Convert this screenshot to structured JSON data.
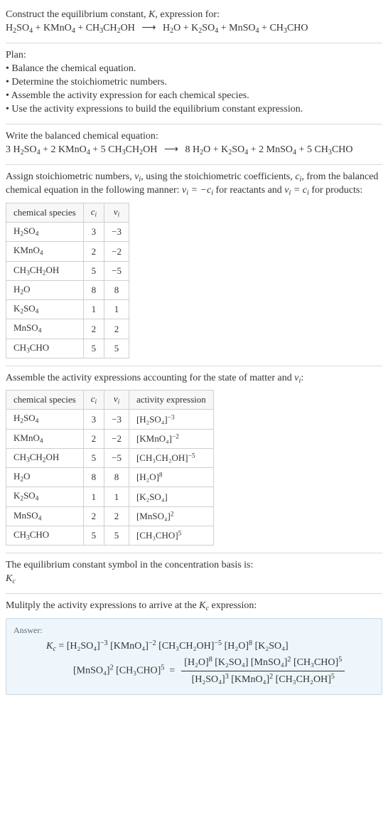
{
  "header": {
    "line1_pre": "Construct the equilibrium constant, ",
    "line1_post": ", expression for:",
    "reaction": {
      "reactants": [
        "H₂SO₄",
        "KMnO₄",
        "CH₃CH₂OH"
      ],
      "products": [
        "H₂O",
        "K₂SO₄",
        "MnSO₄",
        "CH₃CHO"
      ]
    }
  },
  "plan": {
    "title": "Plan:",
    "items": [
      "Balance the chemical equation.",
      "Determine the stoichiometric numbers.",
      "Assemble the activity expression for each chemical species.",
      "Use the activity expressions to build the equilibrium constant expression."
    ]
  },
  "balanced": {
    "title": "Write the balanced chemical equation:",
    "reactants": [
      {
        "coef": "3",
        "sp": "H₂SO₄"
      },
      {
        "coef": "2",
        "sp": "KMnO₄"
      },
      {
        "coef": "5",
        "sp": "CH₃CH₂OH"
      }
    ],
    "products": [
      {
        "coef": "8",
        "sp": "H₂O"
      },
      {
        "coef": "",
        "sp": "K₂SO₄"
      },
      {
        "coef": "2",
        "sp": "MnSO₄"
      },
      {
        "coef": "5",
        "sp": "CH₃CHO"
      }
    ]
  },
  "assign_text_a": "Assign stoichiometric numbers, ",
  "assign_text_b": ", using the stoichiometric coefficients, ",
  "assign_text_c": ", from the balanced chemical equation in the following manner: ",
  "assign_text_d": " for reactants and ",
  "assign_text_e": " for products:",
  "table1": {
    "headers": [
      "chemical species",
      "cᵢ",
      "νᵢ"
    ],
    "rows": [
      {
        "sp": "H₂SO₄",
        "c": "3",
        "v": "−3"
      },
      {
        "sp": "KMnO₄",
        "c": "2",
        "v": "−2"
      },
      {
        "sp": "CH₃CH₂OH",
        "c": "5",
        "v": "−5"
      },
      {
        "sp": "H₂O",
        "c": "8",
        "v": "8"
      },
      {
        "sp": "K₂SO₄",
        "c": "1",
        "v": "1"
      },
      {
        "sp": "MnSO₄",
        "c": "2",
        "v": "2"
      },
      {
        "sp": "CH₃CHO",
        "c": "5",
        "v": "5"
      }
    ]
  },
  "assemble_text_a": "Assemble the activity expressions accounting for the state of matter and ",
  "assemble_text_b": ":",
  "table2": {
    "headers": [
      "chemical species",
      "cᵢ",
      "νᵢ",
      "activity expression"
    ],
    "rows": [
      {
        "sp": "H₂SO₄",
        "c": "3",
        "v": "−3",
        "expr_base": "[H₂SO₄]",
        "expr_exp": "−3"
      },
      {
        "sp": "KMnO₄",
        "c": "2",
        "v": "−2",
        "expr_base": "[KMnO₄]",
        "expr_exp": "−2"
      },
      {
        "sp": "CH₃CH₂OH",
        "c": "5",
        "v": "−5",
        "expr_base": "[CH₃CH₂OH]",
        "expr_exp": "−5"
      },
      {
        "sp": "H₂O",
        "c": "8",
        "v": "8",
        "expr_base": "[H₂O]",
        "expr_exp": "8"
      },
      {
        "sp": "K₂SO₄",
        "c": "1",
        "v": "1",
        "expr_base": "[K₂SO₄]",
        "expr_exp": ""
      },
      {
        "sp": "MnSO₄",
        "c": "2",
        "v": "2",
        "expr_base": "[MnSO₄]",
        "expr_exp": "2"
      },
      {
        "sp": "CH₃CHO",
        "c": "5",
        "v": "5",
        "expr_base": "[CH₃CHO]",
        "expr_exp": "5"
      }
    ]
  },
  "symbol_text": "The equilibrium constant symbol in the concentration basis is:",
  "symbol": "K_c",
  "multiply_text_a": "Mulitply the activity expressions to arrive at the ",
  "multiply_text_b": " expression:",
  "answer": {
    "label": "Answer:",
    "line1": {
      "lhs": "K_c",
      "terms": [
        {
          "base": "[H₂SO₄]",
          "exp": "−3"
        },
        {
          "base": "[KMnO₄]",
          "exp": "−2"
        },
        {
          "base": "[CH₃CH₂OH]",
          "exp": "−5"
        },
        {
          "base": "[H₂O]",
          "exp": "8"
        },
        {
          "base": "[K₂SO₄]",
          "exp": ""
        }
      ]
    },
    "line2_terms": [
      {
        "base": "[MnSO₄]",
        "exp": "2"
      },
      {
        "base": "[CH₃CHO]",
        "exp": "5"
      }
    ],
    "fraction": {
      "num": [
        {
          "base": "[H₂O]",
          "exp": "8"
        },
        {
          "base": "[K₂SO₄]",
          "exp": ""
        },
        {
          "base": "[MnSO₄]",
          "exp": "2"
        },
        {
          "base": "[CH₃CHO]",
          "exp": "5"
        }
      ],
      "den": [
        {
          "base": "[H₂SO₄]",
          "exp": "3"
        },
        {
          "base": "[KMnO₄]",
          "exp": "2"
        },
        {
          "base": "[CH₃CH₂OH]",
          "exp": "5"
        }
      ]
    }
  }
}
